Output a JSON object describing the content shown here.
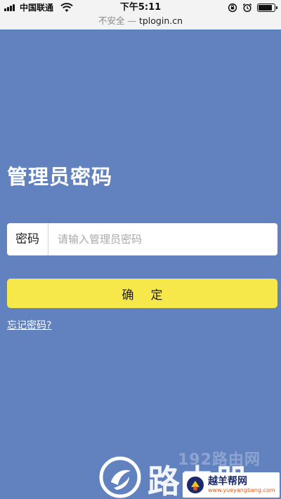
{
  "status_bar": {
    "carrier": "中国联通",
    "time": "下午5:11"
  },
  "url_bar": {
    "security_text": "不安全",
    "separator": "—",
    "domain": "tplogin.cn"
  },
  "login": {
    "title": "管理员密码",
    "password_label": "密码",
    "password_placeholder": "请输入管理员密码",
    "password_value": "",
    "confirm_label": "确定",
    "forgot_link": "忘记密码?"
  },
  "watermark": {
    "site_text": "192路由网",
    "big_text": "路由器",
    "badge_text": "越羊帮网",
    "badge_sub": "www.yueyangbang.com"
  },
  "colors": {
    "background": "#6181bf",
    "confirm_button": "#f6e84a",
    "topbar": "#f3f3f3"
  },
  "icons": [
    "signal-icon",
    "wifi-icon",
    "orientation-lock-icon",
    "alarm-icon",
    "battery-icon"
  ]
}
